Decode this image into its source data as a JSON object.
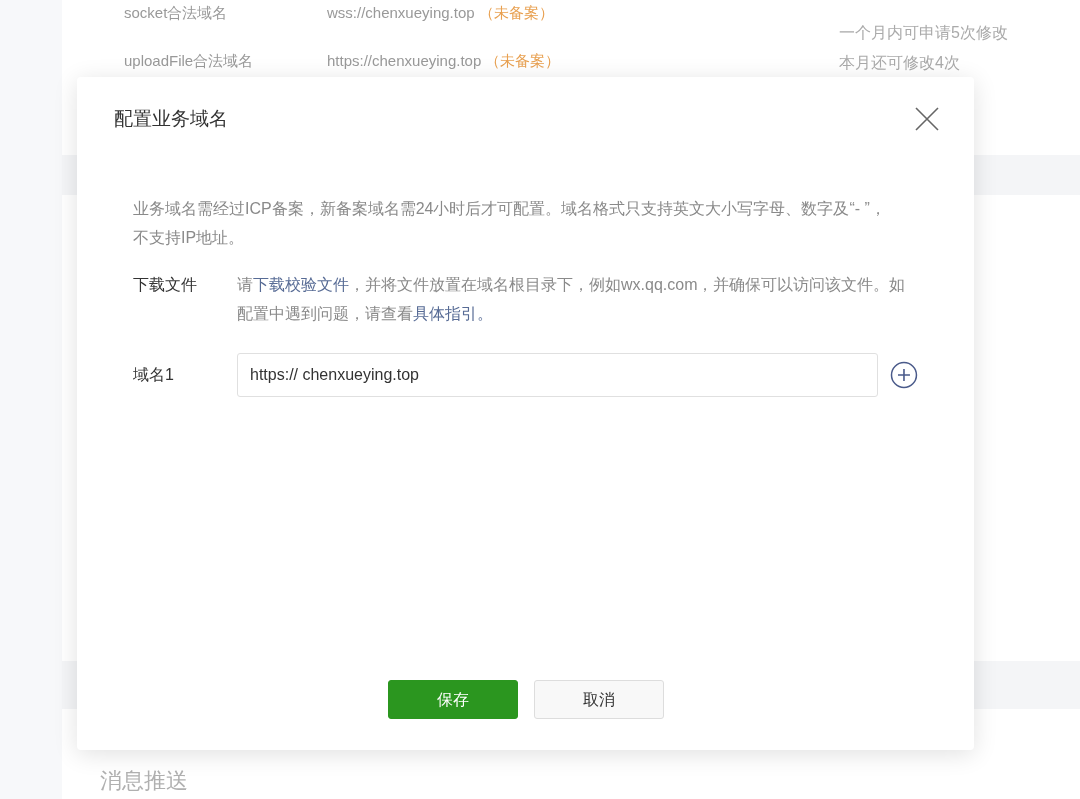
{
  "background": {
    "domain_rows": [
      {
        "label": "socket合法域名",
        "value": "wss://chenxueying.top",
        "status": "（未备案）"
      },
      {
        "label": "uploadFile合法域名",
        "value": "https://chenxueying.top",
        "status": "（未备案）"
      }
    ],
    "notes": [
      "一个月内可申请5次修改",
      "本月还可修改4次"
    ],
    "section_title": "消息推送"
  },
  "dialog": {
    "title": "配置业务域名",
    "notice": "业务域名需经过ICP备案，新备案域名需24小时后才可配置。域名格式只支持英文大小写字母、数字及“- ”，不支持IP地址。",
    "download": {
      "label": "下载文件",
      "segments": [
        {
          "text": "请",
          "link": false
        },
        {
          "text": "下载校验文件",
          "link": true
        },
        {
          "text": "，并将文件放置在域名根目录下，例如wx.qq.com，并确保可以访问该文件。如配置中遇到问题，请查看",
          "link": false
        },
        {
          "text": "具体指引。",
          "link": true
        }
      ]
    },
    "fields": [
      {
        "label": "域名1",
        "value": "https:// chenxueying.top"
      }
    ],
    "buttons": [
      {
        "label": "保存",
        "kind": "primary"
      },
      {
        "label": "取消",
        "kind": "default"
      }
    ]
  }
}
